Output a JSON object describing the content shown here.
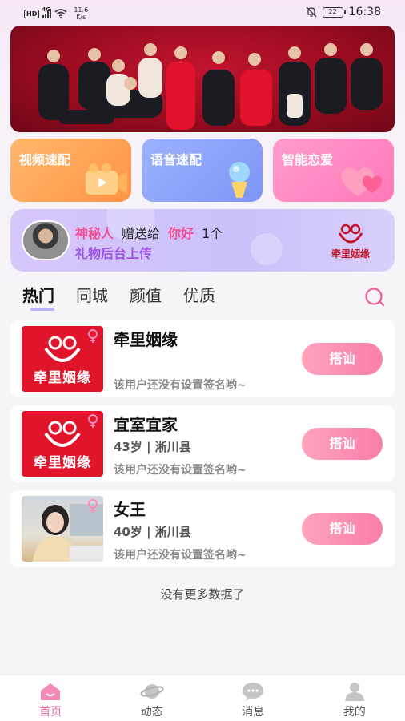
{
  "status_bar": {
    "hd": "HD",
    "network": "4G",
    "speed_value": "11.6",
    "speed_unit": "K/s",
    "battery": "22",
    "time": "16:38",
    "mute_icon": "bell-off-icon"
  },
  "quick_cards": [
    {
      "label": "视频速配",
      "icon": "video-camera-icon"
    },
    {
      "label": "语音速配",
      "icon": "microphone-icon"
    },
    {
      "label": "智能恋爱",
      "icon": "hearts-icon"
    }
  ],
  "gift_banner": {
    "sender": "神秘人",
    "action": "赠送给",
    "receiver": "你好",
    "count": "1个",
    "gift_name": "礼物后台上传",
    "logo_text": "牵里姻缘"
  },
  "tabs": [
    {
      "label": "热门",
      "active": true
    },
    {
      "label": "同城",
      "active": false
    },
    {
      "label": "颜值",
      "active": false
    },
    {
      "label": "优质",
      "active": false
    }
  ],
  "users": [
    {
      "name": "牵里姻缘",
      "meta": "",
      "signature": "该用户还没有设置签名哟~",
      "thumb": "logo",
      "logo_text": "牵里姻缘",
      "button": "搭讪"
    },
    {
      "name": "宜室宜家",
      "meta": "43岁 | 淅川县",
      "signature": "该用户还没有设置签名哟~",
      "thumb": "logo",
      "logo_text": "牵里姻缘",
      "button": "搭讪"
    },
    {
      "name": "女王",
      "meta": "40岁 | 淅川县",
      "signature": "该用户还没有设置签名哟~",
      "thumb": "photo",
      "button": "搭讪"
    }
  ],
  "no_more": "没有更多数据了",
  "bottom_nav": [
    {
      "label": "首页",
      "icon": "home-icon",
      "active": true
    },
    {
      "label": "动态",
      "icon": "planet-icon",
      "active": false
    },
    {
      "label": "消息",
      "icon": "chat-bubble-icon",
      "active": false
    },
    {
      "label": "我的",
      "icon": "person-icon",
      "active": false
    }
  ],
  "colors": {
    "accent_pink": "#f06ba6",
    "button_pink": "#f87ea8",
    "tab_underline": "#b8b2ff",
    "logo_red": "#e0142b"
  }
}
